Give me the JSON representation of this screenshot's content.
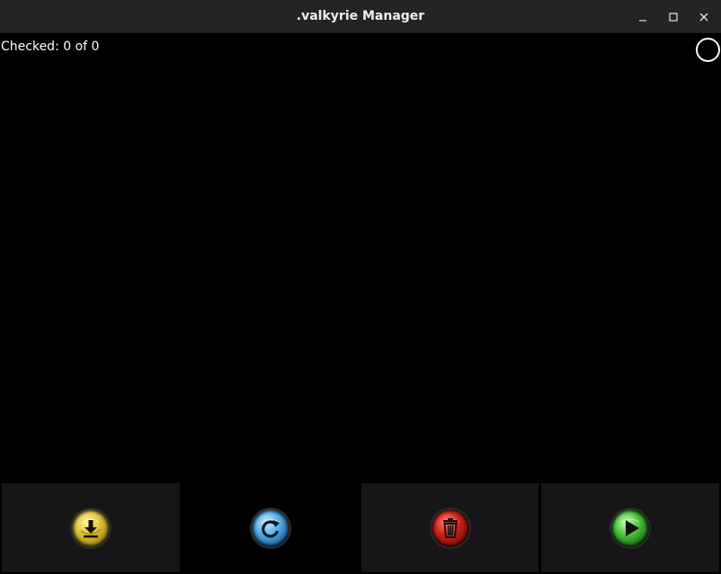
{
  "window": {
    "title": ".valkyrie Manager",
    "controls": {
      "minimize_icon": "minimize-icon",
      "maximize_icon": "maximize-icon",
      "close_icon": "close-icon"
    }
  },
  "status": {
    "checked_text": "Checked: 0 of 0"
  },
  "spinner_icon": "loading-spinner-icon",
  "actions": [
    {
      "name": "download",
      "icon": "download-icon",
      "color": "#d9c13a"
    },
    {
      "name": "refresh",
      "icon": "refresh-icon",
      "color": "#4aa3e0"
    },
    {
      "name": "delete",
      "icon": "trash-icon",
      "color": "#c8201a"
    },
    {
      "name": "play",
      "icon": "play-icon",
      "color": "#3fb83a"
    }
  ],
  "colors": {
    "titlebar": "#242424",
    "background": "#000000",
    "button_bg": "#161616",
    "text": "#ffffff"
  }
}
